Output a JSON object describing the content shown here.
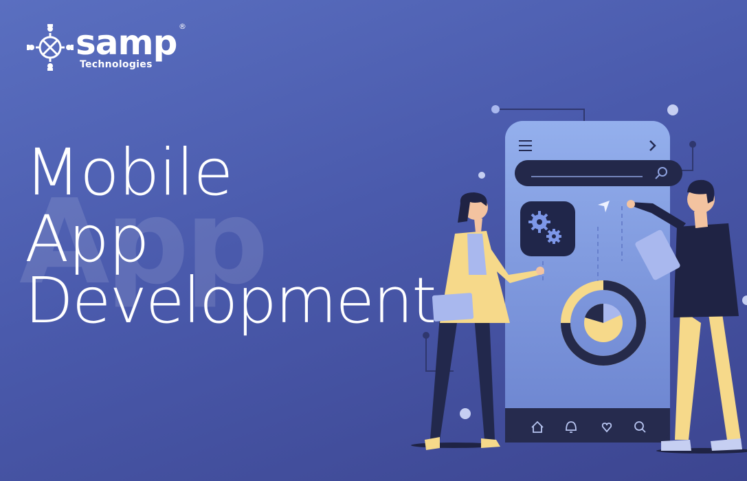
{
  "brand": {
    "name": "samp",
    "registered_mark": "®",
    "subtitle": "Technologies"
  },
  "headline": {
    "line1": "Mobile",
    "line2": "App",
    "line3": "Development",
    "watermark": "App"
  },
  "colors": {
    "background_top": "#5a6fc0",
    "background_bottom": "#3c4590",
    "phone_body": "#7f9be0",
    "phone_dark": "#252a4a",
    "accent_yellow": "#f6d98a",
    "navy": "#1f2344"
  },
  "phone": {
    "top_icons": [
      "menu-icon",
      "chevron-right-icon"
    ],
    "search_icon": "search-icon",
    "settings_tile_icon": "gears-icon",
    "nav_icons": [
      "home-icon",
      "bell-icon",
      "heart-icon",
      "search-icon"
    ]
  }
}
